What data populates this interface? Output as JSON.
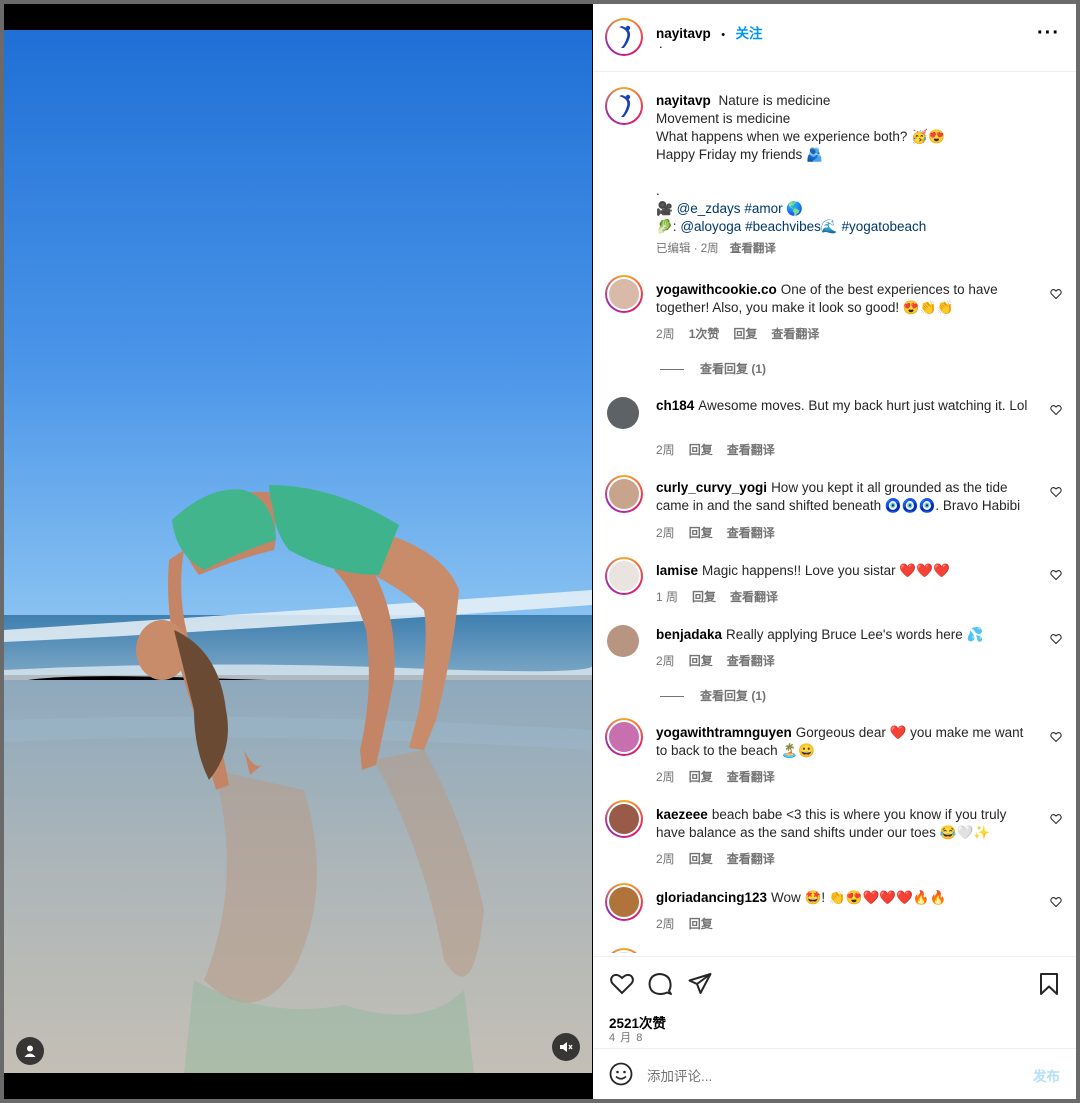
{
  "post": {
    "username": "nayitavp",
    "separator": "•",
    "follow_label": "关注",
    "sub_dot": ".",
    "more_icon": "more-horizontal-icon"
  },
  "caption": {
    "username": "nayitavp",
    "line1": "Nature is medicine",
    "line2": "Movement is medicine",
    "line3": "What happens when we experience both? 🥳😍",
    "line4": "Happy Friday my friends 🫂",
    "dot": ".",
    "credits1_prefix": "🎥 ",
    "credits1_mention": "@e_zdays",
    "credits1_tag": "#amor",
    "credits1_suffix": " 🌎",
    "credits2_prefix": "🥬: ",
    "credits2_mention": "@aloyoga",
    "credits2_tag1": "#beachvibes🌊",
    "credits2_tag2": "#yogatobeach",
    "meta_edited": "已编辑 · 2周",
    "meta_translate": "查看翻译"
  },
  "comments": [
    {
      "username": "yogawithcookie.co",
      "text": "One of the best experiences to have together! Also, you make it look so good! 😍👏👏",
      "time": "2周",
      "likes": "1次赞",
      "reply": "回复",
      "translate": "查看翻译",
      "view_replies": "查看回复 (1)"
    },
    {
      "username": "ch184",
      "text": "Awesome moves. But my back hurt just watching it. Lol",
      "time": "2周",
      "reply": "回复",
      "translate": "查看翻译"
    },
    {
      "username": "curly_curvy_yogi",
      "text": "How you kept it all grounded as the tide came in and the sand shifted beneath 🧿🧿🧿. Bravo Habibi",
      "time": "2周",
      "reply": "回复",
      "translate": "查看翻译"
    },
    {
      "username": "lamise",
      "text": "Magic happens!! Love you sistar ❤️❤️❤️",
      "time": "1 周",
      "reply": "回复",
      "translate": "查看翻译"
    },
    {
      "username": "benjadaka",
      "text": "Really applying Bruce Lee's words here 💦",
      "time": "2周",
      "reply": "回复",
      "translate": "查看翻译",
      "view_replies": "查看回复 (1)"
    },
    {
      "username": "yogawithtramnguyen",
      "text": "Gorgeous dear ❤️ you make me want to back to the beach 🏝️😀",
      "time": "2周",
      "reply": "回复",
      "translate": "查看翻译"
    },
    {
      "username": "kaezeee",
      "text": "beach babe <3 this is where you know if you truly have balance as the sand shifts under our toes 😂🤍✨",
      "time": "2周",
      "reply": "回复",
      "translate": "查看翻译"
    },
    {
      "username": "gloriadancing123",
      "text": "Wow 🤩! 👏😍❤️❤️❤️🔥🔥",
      "time": "2周",
      "reply": "回复"
    }
  ],
  "actions": {
    "like_icon": "heart-icon",
    "comment_icon": "comment-bubble-icon",
    "share_icon": "paper-plane-icon",
    "save_icon": "bookmark-icon",
    "likes_count": "2521次赞",
    "date": "4 月 8"
  },
  "comment_bar": {
    "emoji_icon": "smiley-icon",
    "placeholder": "添加评论...",
    "post_label": "发布"
  },
  "media": {
    "user_tag_icon": "person-icon",
    "mute_icon": "speaker-muted-icon"
  }
}
